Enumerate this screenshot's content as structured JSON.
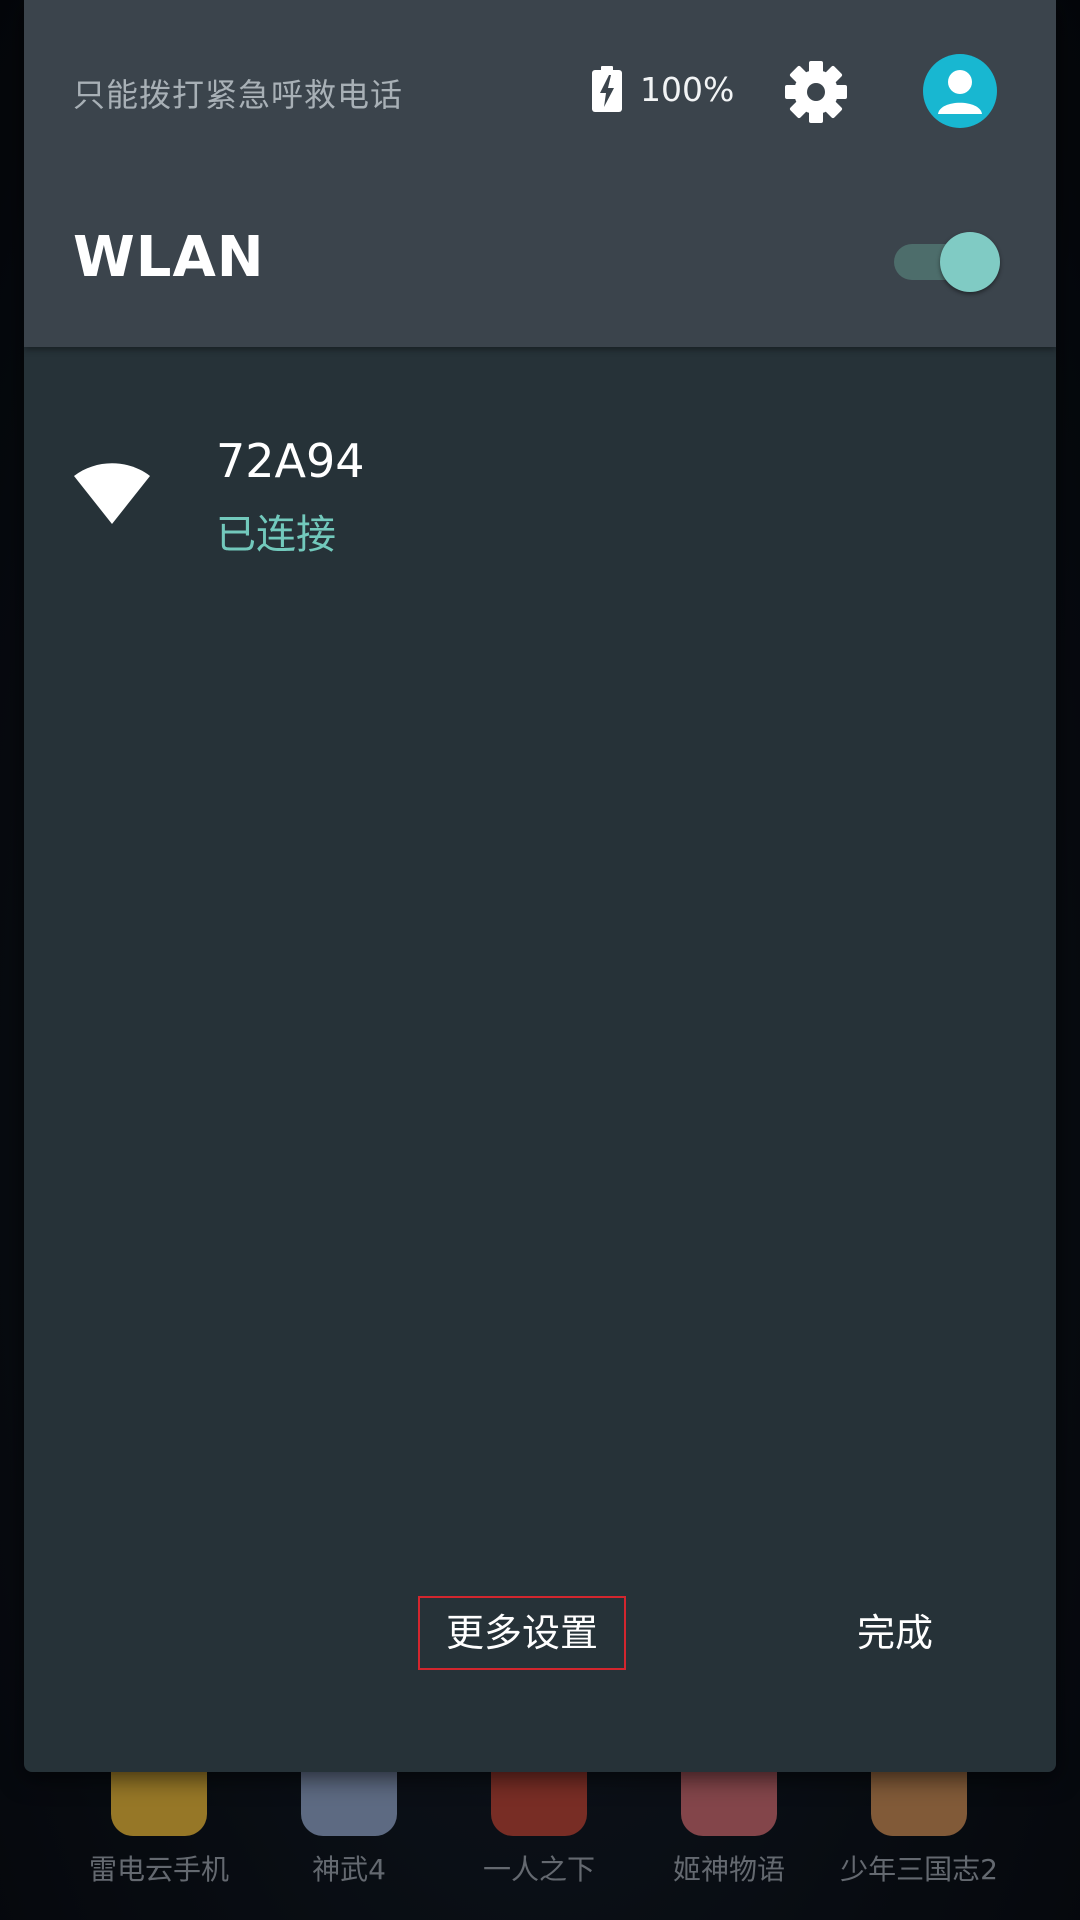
{
  "status_bar": {
    "emergency_text": "只能拨打紧急呼救电话",
    "battery_percent": "100%"
  },
  "wlan": {
    "title": "WLAN",
    "toggle_on": true
  },
  "networks": [
    {
      "name": "72A94",
      "status": "已连接"
    }
  ],
  "footer": {
    "more_settings_label": "更多设置",
    "done_label": "完成"
  },
  "dock": {
    "apps": [
      {
        "label": "雷电云手机",
        "color": "#e6b73c"
      },
      {
        "label": "神武4",
        "color": "#8fa3c8"
      },
      {
        "label": "一人之下",
        "color": "#b9463a"
      },
      {
        "label": "姬神物语",
        "color": "#c96b72"
      },
      {
        "label": "少年三国志2",
        "color": "#c78a56"
      }
    ]
  },
  "colors": {
    "accent": "#80cbc4",
    "connected_text": "#72c9bc",
    "avatar": "#18b7d1",
    "panel_bg": "#263238",
    "header_bg": "#3b444c",
    "highlight_border": "#d3262e"
  }
}
